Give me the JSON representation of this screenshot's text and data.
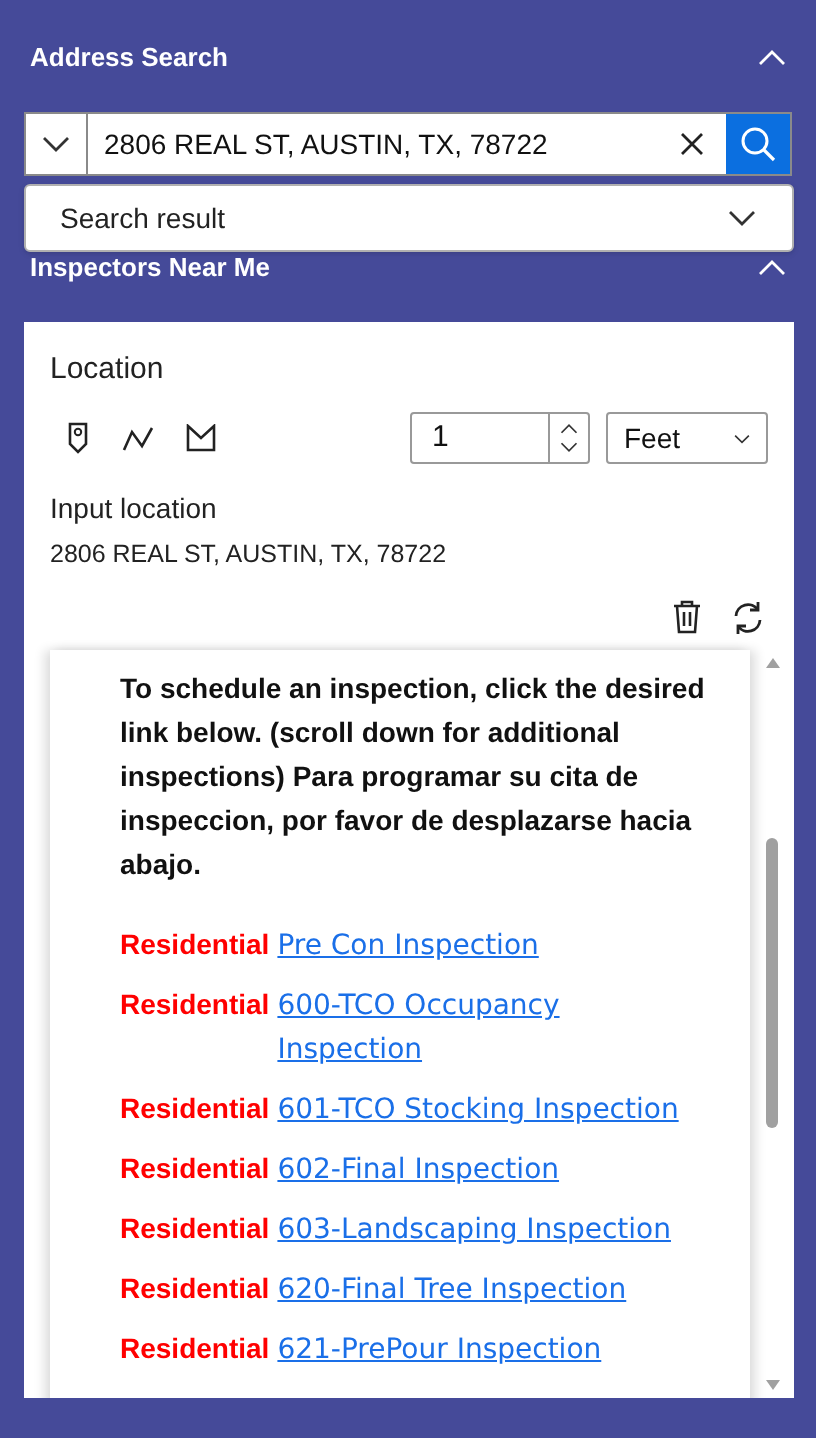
{
  "address_search": {
    "title": "Address Search",
    "expanded": true,
    "search": {
      "value": "2806 REAL ST, AUSTIN, TX, 78722"
    },
    "result_dropdown": {
      "label": "Search result"
    }
  },
  "inspectors_panel": {
    "title": "Inspectors Near Me",
    "expanded": true,
    "location": {
      "label": "Location",
      "distance": "1",
      "unit": "Feet",
      "input_label": "Input location",
      "input_value": "2806 REAL ST, AUSTIN, TX, 78722"
    },
    "intro": "To schedule an inspection, click the desired link below. (scroll down for additional inspections) Para programar su cita de inspeccion, por favor de desplazarse hacia abajo.",
    "links": [
      {
        "category": "Residential",
        "label": "Pre Con Inspection"
      },
      {
        "category": "Residential",
        "label": "600-TCO Occupancy Inspection"
      },
      {
        "category": "Residential",
        "label": "601-TCO Stocking Inspection"
      },
      {
        "category": "Residential",
        "label": "602-Final Inspection"
      },
      {
        "category": "Residential",
        "label": "603-Landscaping Inspection"
      },
      {
        "category": "Residential",
        "label": "620-Final Tree Inspection"
      },
      {
        "category": "Residential",
        "label": "621-PrePour Inspection"
      }
    ]
  }
}
